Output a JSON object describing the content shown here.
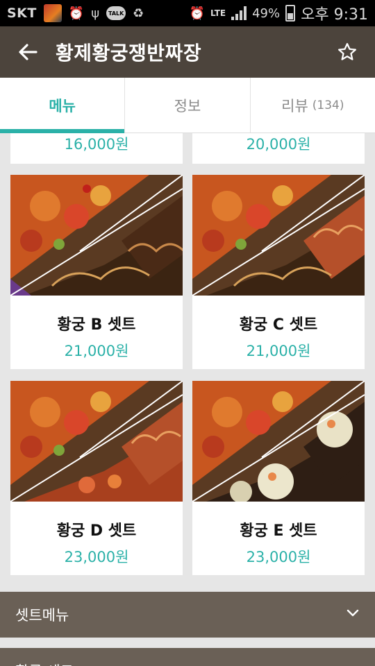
{
  "status": {
    "carrier": "SKT",
    "talk": "TALK",
    "network": "LTE",
    "battery": "49%",
    "time": "오후 9:31",
    "icons": [
      "app-icon",
      "alarm-icon",
      "usb-icon",
      "talk-icon",
      "recycle-icon",
      "clock-icon",
      "signal-icon",
      "battery-icon"
    ]
  },
  "appbar": {
    "title": "황제황궁쟁반짜장",
    "back_icon": "arrow-left-icon",
    "star_icon": "star-outline-icon"
  },
  "tabs": [
    {
      "label": "메뉴",
      "count": "",
      "active": true
    },
    {
      "label": "정보",
      "count": "",
      "active": false
    },
    {
      "label": "리뷰",
      "count": "(134)",
      "active": false
    }
  ],
  "menu": {
    "partial_prices": [
      "16,000원",
      "20,000원"
    ],
    "items": [
      {
        "name": "황궁 B 셋트",
        "price": "21,000원"
      },
      {
        "name": "황궁 C 셋트",
        "price": "21,000원"
      },
      {
        "name": "황궁 D 셋트",
        "price": "23,000원"
      },
      {
        "name": "황궁 E 셋트",
        "price": "23,000원"
      }
    ]
  },
  "sections": [
    {
      "label": "셋트메뉴",
      "icon": "chevron-down-icon"
    },
    {
      "label": "황궁 세트"
    }
  ],
  "colors": {
    "accent": "#2bb1a8",
    "appbar": "#4c443c",
    "section": "#6a6056"
  }
}
